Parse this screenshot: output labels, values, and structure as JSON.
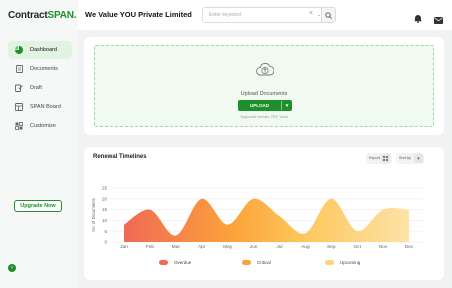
{
  "brand": {
    "logo_main": "Contract",
    "logo_accent": "SPAN."
  },
  "sidebar": {
    "items": [
      {
        "label": "Dashboard",
        "icon": "dashboard-icon",
        "active": true
      },
      {
        "label": "Documents",
        "icon": "document-icon",
        "active": false
      },
      {
        "label": "Draft",
        "icon": "draft-icon",
        "active": false
      },
      {
        "label": "SPAN Board",
        "icon": "board-icon",
        "active": false
      },
      {
        "label": "Customize",
        "icon": "customize-icon",
        "active": false
      }
    ],
    "upgrade_label": "Upgrade Now"
  },
  "header": {
    "company_name": "We Value YOU Private Limited",
    "search_placeholder": "Enter keyword"
  },
  "upload": {
    "title": "Upload Documents",
    "button_label": "UPLOAD",
    "supported_text": "Supported formats: PDF, Word"
  },
  "renewal": {
    "title": "Renewal Timelines",
    "export_label": "Export",
    "sort_label": "Sort by"
  },
  "colors": {
    "brand": "#1f8f2b",
    "overdue": "#f06a55",
    "critical": "#fca23a",
    "upcoming": "#fdd37a"
  },
  "chart_data": {
    "type": "area",
    "categories": [
      "Jan",
      "Feb",
      "Mar",
      "Apr",
      "May",
      "Jun",
      "Jul",
      "Aug",
      "Sep",
      "Oct",
      "Nov",
      "Dec"
    ],
    "values": [
      8,
      15,
      3,
      20,
      8,
      20,
      12,
      4,
      20,
      5,
      15,
      15
    ],
    "ylabel": "No. of Documents",
    "xlabel": "",
    "ylim": [
      0,
      25
    ],
    "yticks": [
      0,
      5,
      10,
      15,
      20,
      25
    ],
    "legend": [
      "Overdue",
      "Critical",
      "Upcoming"
    ],
    "legend_position": "bottom",
    "grid": true
  }
}
